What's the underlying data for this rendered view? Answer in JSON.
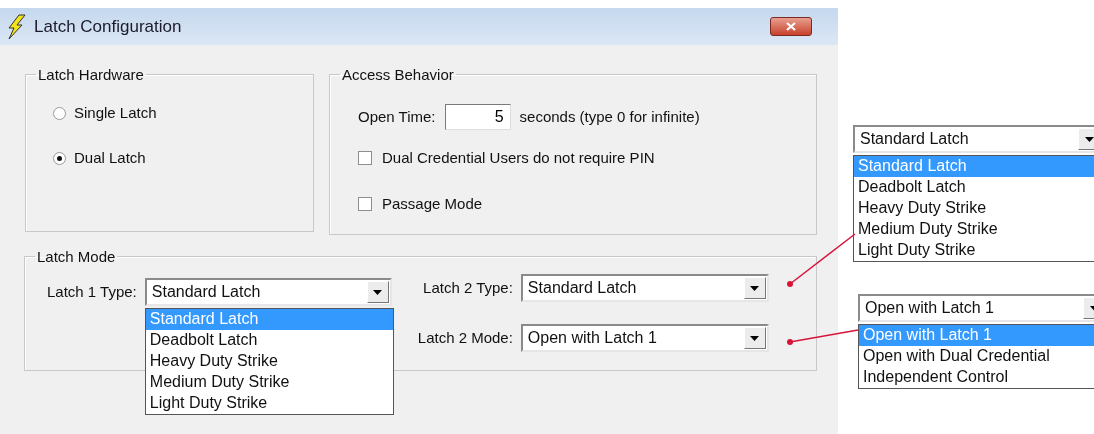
{
  "window": {
    "title": "Latch Configuration"
  },
  "latch_hardware": {
    "title": "Latch Hardware",
    "options": [
      {
        "label": "Single Latch",
        "selected": false
      },
      {
        "label": "Dual Latch",
        "selected": true
      }
    ]
  },
  "access_behavior": {
    "title": "Access Behavior",
    "open_time": {
      "label": "Open Time:",
      "value": "5",
      "suffix": "seconds (type 0 for infinite)"
    },
    "checkboxes": [
      {
        "label": "Dual Credential Users do not require PIN",
        "checked": false
      },
      {
        "label": "Passage Mode",
        "checked": false
      }
    ]
  },
  "latch_mode": {
    "title": "Latch Mode",
    "fields": [
      {
        "label": "Latch 1 Type:",
        "value": "Standard Latch",
        "options": [
          {
            "label": "Standard Latch",
            "selected": true
          },
          {
            "label": "Deadbolt Latch",
            "selected": false
          },
          {
            "label": "Heavy Duty Strike",
            "selected": false
          },
          {
            "label": "Medium Duty Strike",
            "selected": false
          },
          {
            "label": "Light Duty Strike",
            "selected": false
          }
        ]
      },
      {
        "label": "Latch 2 Type:",
        "value": "Standard Latch"
      },
      {
        "label": "Latch 2 Mode:",
        "value": "Open with Latch 1"
      }
    ]
  },
  "callouts": [
    {
      "value": "Standard Latch",
      "options": [
        {
          "label": "Standard Latch",
          "selected": true
        },
        {
          "label": "Deadbolt Latch",
          "selected": false
        },
        {
          "label": "Heavy Duty Strike",
          "selected": false
        },
        {
          "label": "Medium Duty Strike",
          "selected": false
        },
        {
          "label": "Light Duty Strike",
          "selected": false
        }
      ]
    },
    {
      "value": "Open with Latch 1",
      "options": [
        {
          "label": "Open with Latch 1",
          "selected": true
        },
        {
          "label": "Open with Dual Credential",
          "selected": false
        },
        {
          "label": "Independent Control",
          "selected": false
        }
      ]
    }
  ]
}
